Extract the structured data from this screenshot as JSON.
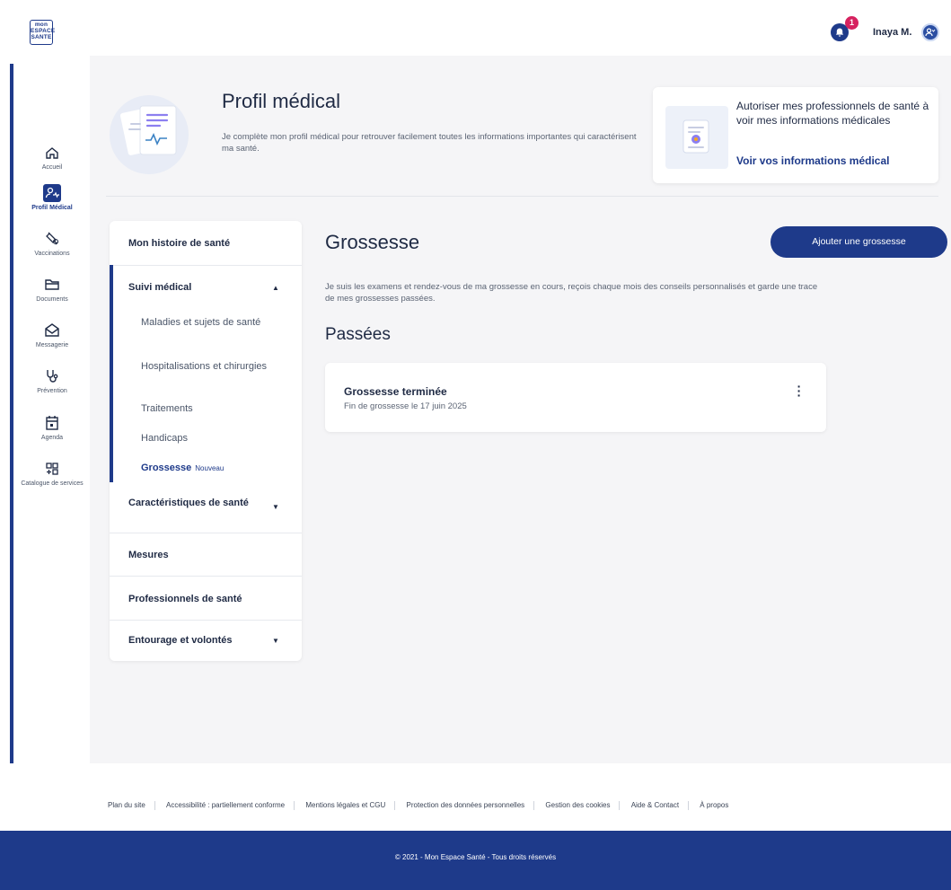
{
  "header": {
    "logo_lines": [
      "mon",
      "ESPACE",
      "SANTE"
    ],
    "notifications_count": "1",
    "user_name": "Inaya M."
  },
  "sidebar": {
    "items": [
      {
        "label": "Accueil",
        "icon": "home-icon"
      },
      {
        "label": "Profil Médical",
        "icon": "profile-medical-icon",
        "active": true
      },
      {
        "label": "Vaccinations",
        "icon": "syringe-icon"
      },
      {
        "label": "Documents",
        "icon": "folder-icon"
      },
      {
        "label": "Messagerie",
        "icon": "mail-icon"
      },
      {
        "label": "Prévention",
        "icon": "stethoscope-icon"
      },
      {
        "label": "Agenda",
        "icon": "calendar-icon"
      },
      {
        "label": "Catalogue de services",
        "icon": "grid-icon"
      }
    ]
  },
  "profile": {
    "title": "Profil médical",
    "description": "Je complète mon profil médical pour retrouver facilement toutes les informations importantes qui caractérisent ma santé."
  },
  "auth_card": {
    "text": "Autoriser mes professionnels de santé à voir mes informations médicales",
    "link": "Voir vos informations médical"
  },
  "menu": {
    "history": "Mon histoire de santé",
    "followup": "Suivi médical",
    "sub_items": [
      "Maladies et sujets de santé",
      "Hospitalisations et chirurgies",
      "Traitements",
      "Handicaps"
    ],
    "current": "Grossesse",
    "current_badge": "Nouveau",
    "characteristics": "Caractéristiques de santé",
    "measures": "Mesures",
    "professionals": "Professionnels de santé",
    "entourage": "Entourage et volontés"
  },
  "content": {
    "title": "Grossesse",
    "add_button": "Ajouter une grossesse",
    "intro": "Je suis les examens et rendez-vous de ma grossesse en cours, reçois chaque mois des conseils personnalisés et garde une trace de mes grossesses passées.",
    "past_title": "Passées",
    "card_title": "Grossesse terminée",
    "card_subtitle": "Fin de grossesse le 17 juin 2025"
  },
  "footer": {
    "links": [
      "Plan du site",
      "Accessibilité : partiellement conforme",
      "Mentions légales et CGU",
      "Protection des données personnelles",
      "Gestion des cookies",
      "Aide & Contact",
      "À propos"
    ],
    "copyright": "© 2021 - Mon Espace Santé - Tous droits réservés"
  },
  "colors": {
    "primary": "#1e3a8a",
    "badge": "#d6225f",
    "background": "#f5f5f7"
  }
}
